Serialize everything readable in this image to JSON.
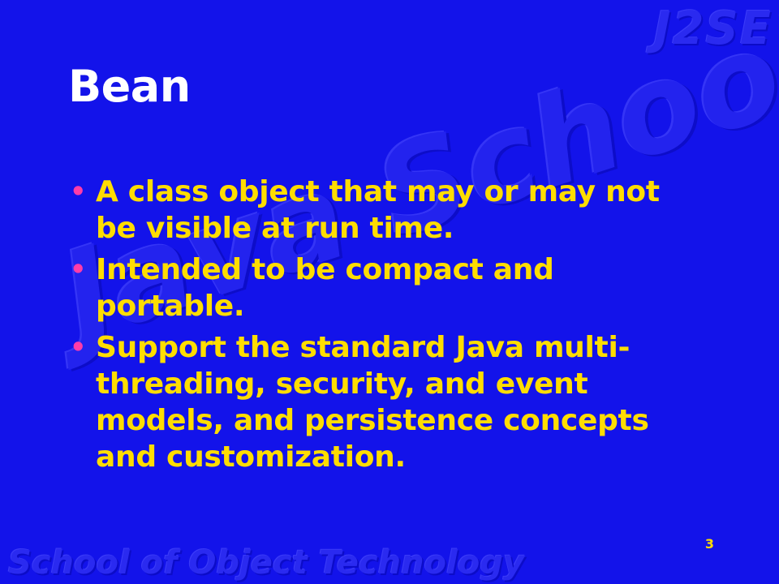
{
  "slide": {
    "title": "Bean",
    "bullets": [
      {
        "text": "A class object that may or may not be visible at run time."
      },
      {
        "text": "Intended to be compact and portable."
      },
      {
        "text": "Support the standard Java multi-threading, security, and event models, and persistence concepts and customization."
      }
    ],
    "page_number": "3"
  },
  "watermarks": {
    "corner": "J2SE",
    "center": "Java School",
    "footer": "School of Object Technology"
  },
  "colors": {
    "background": "#1313ea",
    "title": "#ffffff",
    "bullet_text": "#ffdd00",
    "bullet_marker": "#ff3ca8",
    "page_number": "#ffdd00"
  }
}
